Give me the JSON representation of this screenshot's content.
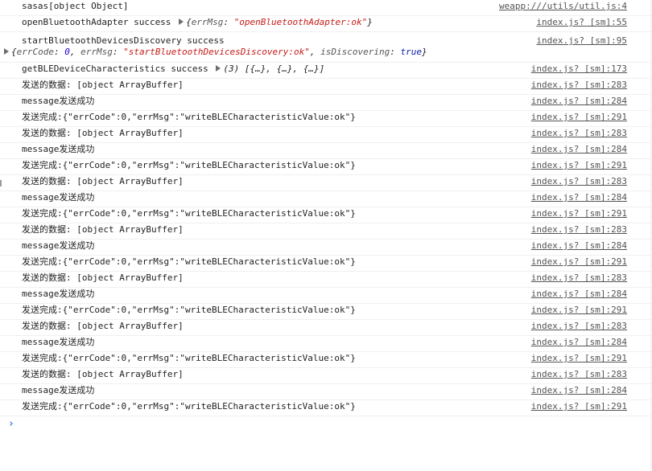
{
  "console": {
    "rows": [
      {
        "type": "text",
        "text": "sasas[object Object]",
        "source": "weapp:///utils/util.js:4"
      },
      {
        "type": "adapter",
        "text": "openBluetoothAdapter success ",
        "k1": "errMsg",
        "v1": "\"openBluetoothAdapter:ok\"",
        "source": "index.js? [sm]:55"
      },
      {
        "type": "discovery",
        "text": "startBluetoothDevicesDiscovery success",
        "k1": "errCode",
        "v1": "0",
        "k2": "errMsg",
        "v2": "\"startBluetoothDevicesDiscovery:ok\"",
        "k3": "isDiscovering",
        "v3": "true",
        "source": "index.js? [sm]:95"
      },
      {
        "type": "chars",
        "text": "getBLEDeviceCharacteristics success ",
        "summary": "(3) [{…}, {…}, {…}]",
        "source": "index.js? [sm]:173"
      },
      {
        "type": "text",
        "text": "发送的数据: [object ArrayBuffer]",
        "source": "index.js? [sm]:283"
      },
      {
        "type": "text",
        "text": "message发送成功",
        "source": "index.js? [sm]:284"
      },
      {
        "type": "text",
        "text": "发送完成:{\"errCode\":0,\"errMsg\":\"writeBLECharacteristicValue:ok\"}",
        "source": "index.js? [sm]:291"
      },
      {
        "type": "text",
        "text": "发送的数据: [object ArrayBuffer]",
        "source": "index.js? [sm]:283"
      },
      {
        "type": "text",
        "text": "message发送成功",
        "source": "index.js? [sm]:284"
      },
      {
        "type": "text",
        "text": "发送完成:{\"errCode\":0,\"errMsg\":\"writeBLECharacteristicValue:ok\"}",
        "source": "index.js? [sm]:291"
      },
      {
        "type": "text",
        "text": "发送的数据: [object ArrayBuffer]",
        "source": "index.js? [sm]:283"
      },
      {
        "type": "text",
        "text": "message发送成功",
        "source": "index.js? [sm]:284"
      },
      {
        "type": "text",
        "text": "发送完成:{\"errCode\":0,\"errMsg\":\"writeBLECharacteristicValue:ok\"}",
        "source": "index.js? [sm]:291"
      },
      {
        "type": "text",
        "text": "发送的数据: [object ArrayBuffer]",
        "source": "index.js? [sm]:283"
      },
      {
        "type": "text",
        "text": "message发送成功",
        "source": "index.js? [sm]:284"
      },
      {
        "type": "text",
        "text": "发送完成:{\"errCode\":0,\"errMsg\":\"writeBLECharacteristicValue:ok\"}",
        "source": "index.js? [sm]:291"
      },
      {
        "type": "text",
        "text": "发送的数据: [object ArrayBuffer]",
        "source": "index.js? [sm]:283"
      },
      {
        "type": "text",
        "text": "message发送成功",
        "source": "index.js? [sm]:284"
      },
      {
        "type": "text",
        "text": "发送完成:{\"errCode\":0,\"errMsg\":\"writeBLECharacteristicValue:ok\"}",
        "source": "index.js? [sm]:291"
      },
      {
        "type": "text",
        "text": "发送的数据: [object ArrayBuffer]",
        "source": "index.js? [sm]:283"
      },
      {
        "type": "text",
        "text": "message发送成功",
        "source": "index.js? [sm]:284"
      },
      {
        "type": "text",
        "text": "发送完成:{\"errCode\":0,\"errMsg\":\"writeBLECharacteristicValue:ok\"}",
        "source": "index.js? [sm]:291"
      },
      {
        "type": "text",
        "text": "发送的数据: [object ArrayBuffer]",
        "source": "index.js? [sm]:283"
      },
      {
        "type": "text",
        "text": "message发送成功",
        "source": "index.js? [sm]:284"
      },
      {
        "type": "text",
        "text": "发送完成:{\"errCode\":0,\"errMsg\":\"writeBLECharacteristicValue:ok\"}",
        "source": "index.js? [sm]:291"
      }
    ],
    "prompt_glyph": "›"
  },
  "icons": {
    "expand": "expand-triangle-icon",
    "prompt": "chevron-right-icon"
  },
  "colors": {
    "string": "#c41a16",
    "number": "#1c00cf",
    "prompt": "#3879d9",
    "link": "#545454"
  }
}
